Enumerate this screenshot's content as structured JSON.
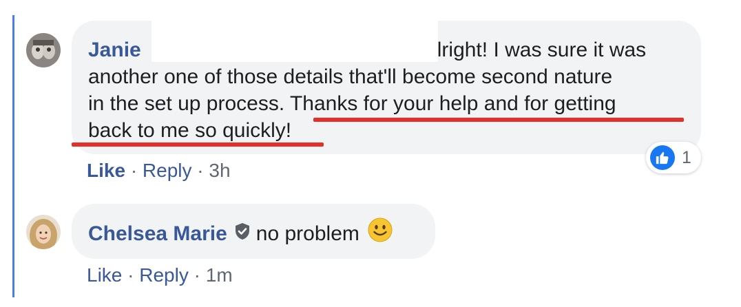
{
  "comments": [
    {
      "author": "Janie",
      "author_suffix": "",
      "text_line1": "alright! I was sure it was",
      "text_line2": "another one of those details that'll become second nature",
      "text_line3_a": "in the set up process. ",
      "text_line3_b": "Thanks for your help and for getting",
      "text_line4": "back to me so quickly!",
      "reaction_count": "1",
      "actions": {
        "like": "Like",
        "reply": "Reply",
        "sep": "·",
        "time": "3h"
      }
    },
    {
      "author": "Chelsea Marie",
      "text": "no problem",
      "actions": {
        "like": "Like",
        "reply": "Reply",
        "sep": "·",
        "time": "1m"
      }
    }
  ],
  "colors": {
    "thread_line": "#4a7de8",
    "bubble": "#f2f3f5",
    "author": "#385898",
    "underline": "#e3302b",
    "like_blue": "#1877f2"
  },
  "icons": {
    "reaction": "thumbs-up-icon",
    "badge": "shield-check-icon",
    "emoji": "smiling-face-emoji"
  }
}
